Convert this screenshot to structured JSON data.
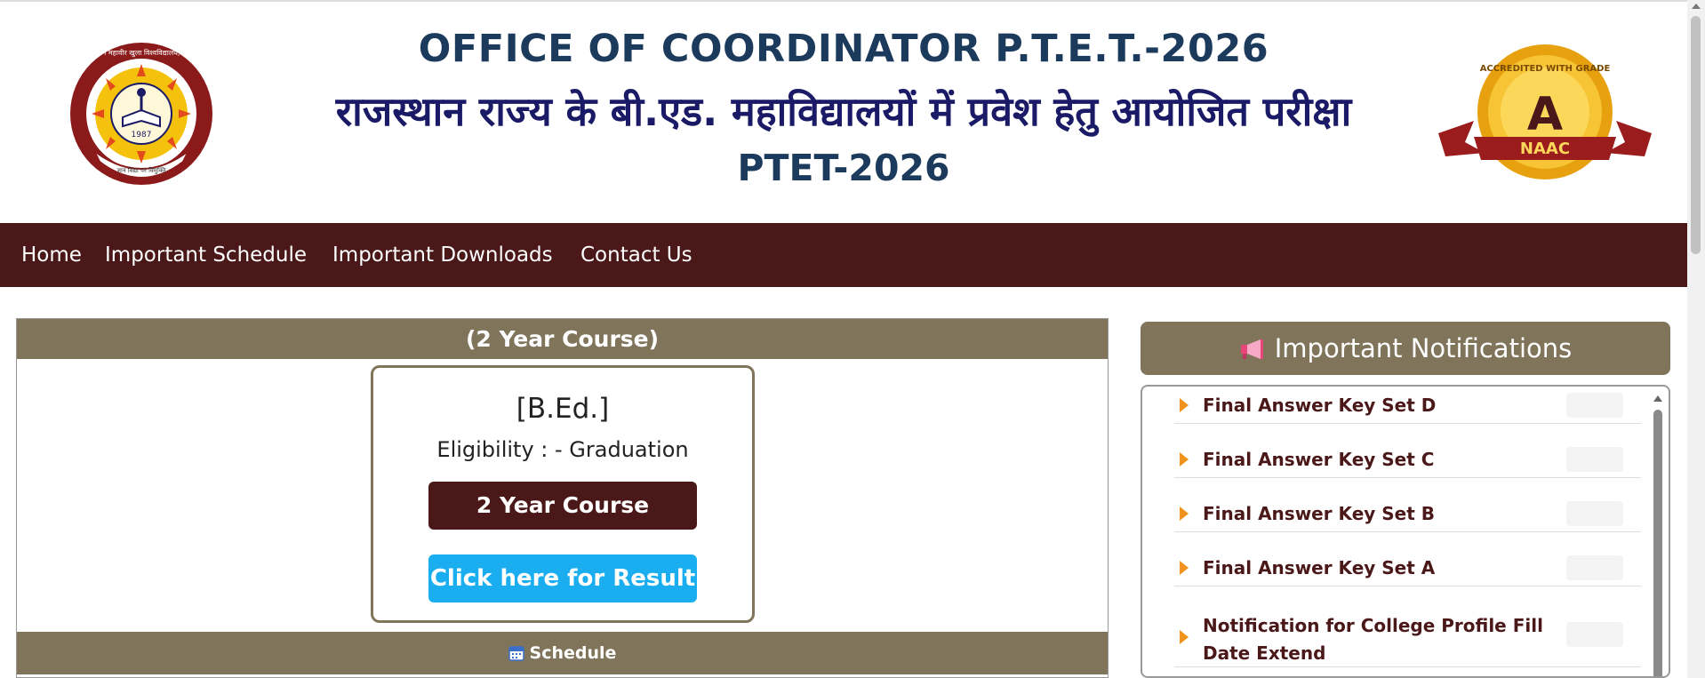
{
  "header": {
    "title_en": "OFFICE OF COORDINATOR P.T.E.T.-2026",
    "title_hi": "राजस्थान राज्य के बी.एड. महाविद्यालयों में प्रवेश हेतु आयोजित परीक्षा",
    "title_short": "PTET-2026",
    "left_logo": {
      "icon": "university-seal-icon",
      "text": "वर्धमान महावीर खुला विश्वविद्यालय, कोटा",
      "year": "1987",
      "motto": "ज्ञान विद्या पर विमुक्ति"
    },
    "right_logo": {
      "icon": "naac-a-grade-badge-icon",
      "ring_text": "ACCREDITED WITH GRADE",
      "grade": "A",
      "ribbon": "NAAC"
    }
  },
  "nav": {
    "items": [
      "Home",
      "Important Schedule",
      "Important Downloads",
      "Contact Us"
    ]
  },
  "course": {
    "bar_title": "(2 Year Course)",
    "card_title": "[B.Ed.]",
    "eligibility": "Eligibility : - Graduation",
    "course_button": "2 Year Course",
    "result_button": "Click here for Result",
    "schedule_label": "Schedule",
    "schedule_icon": "calendar-icon"
  },
  "notifications": {
    "title": "Important Notifications",
    "icon": "megaphone-icon",
    "items": [
      "Final Answer Key Set D",
      "Final Answer Key Set C",
      "Final Answer Key Set B",
      "Final Answer Key Set A",
      "Notification for College Profile Fill Date Extend"
    ]
  },
  "colors": {
    "nav_bg": "#4a1818",
    "panel_bar": "#80745a",
    "result_button": "#1aaef0",
    "title_blue": "#1b3a5c",
    "notif_text": "#4a1818",
    "bullet": "#f0921e"
  }
}
